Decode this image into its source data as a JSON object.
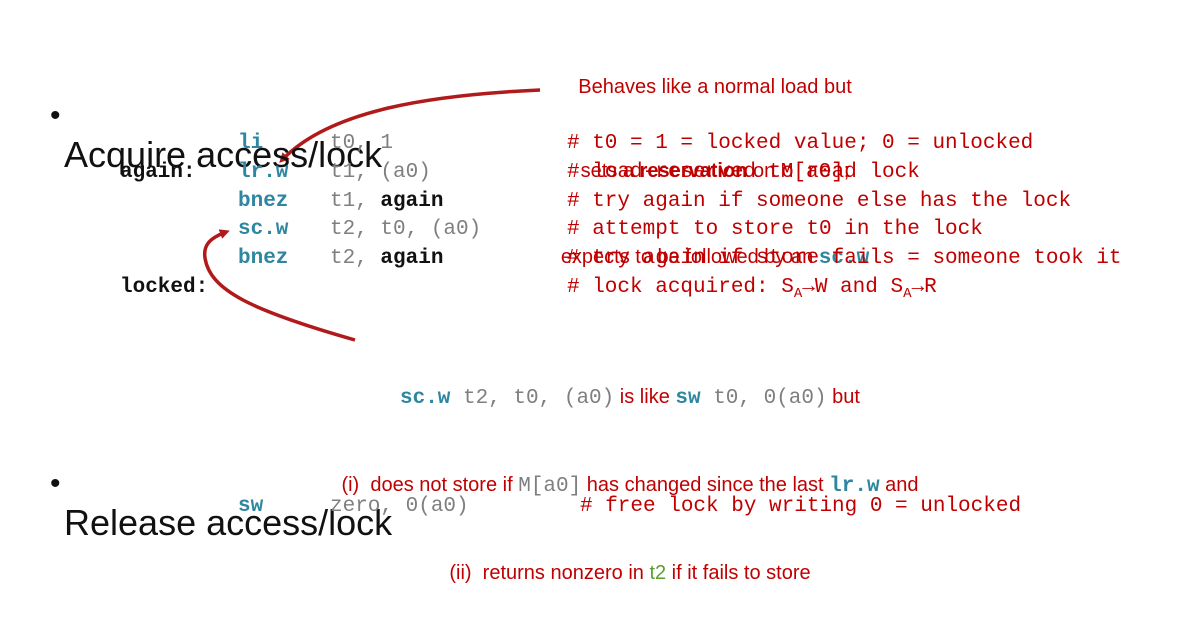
{
  "bullets": {
    "acquire": "Acquire access/lock",
    "release": "Release access/lock",
    "marker": "•"
  },
  "top_note": {
    "line1": "Behaves like a normal load but",
    "line2_pre": "sets a ",
    "line2_bold": "reservation",
    "line2_mid": " on ",
    "line2_code": "M[a0]",
    "line2_post": ";",
    "line3_pre": "expects to be followed by an ",
    "line3_code": "sc.w"
  },
  "code": [
    {
      "label": "",
      "op": "li",
      "a1": "t0, 1",
      "a2": "",
      "comment": "# t0 = 1 = locked value; 0 = unlocked"
    },
    {
      "label": "again:",
      "op": "lr.w",
      "a1": "t1, (a0)",
      "a2": "",
      "comment": "# load-reserved to read lock"
    },
    {
      "label": "",
      "op": "bnez",
      "a1": "t1, ",
      "a2": "again",
      "comment": "# try again if someone else has the lock"
    },
    {
      "label": "",
      "op": "sc.w",
      "a1": "t2, t0, (a0)",
      "a2": "",
      "comment": "# attempt to store t0 in the lock"
    },
    {
      "label": "",
      "op": "bnez",
      "a1": "t2, ",
      "a2": "again",
      "comment": "# try again if store fails = someone took it"
    },
    {
      "label": "locked:",
      "op": "",
      "a1": "",
      "a2": "",
      "comment": "# lock acquired: S"
    }
  ],
  "locked_comment": {
    "sub": "A",
    "arrow1": "→W and S",
    "arrow2": "→R"
  },
  "bottom_note": {
    "l1_code1": "sc.w",
    "l1_code1b": " t2, t0, (a0)",
    "l1_text1": " is like ",
    "l1_code2": "sw",
    "l1_code2b": " t0, 0(a0)",
    "l1_text2": " but",
    "l2_text1": "(i)  does not store if ",
    "l2_code1": "M[a0]",
    "l2_text2": " has changed since the last ",
    "l2_code2": "lr.w",
    "l2_text3": " and",
    "l3_text1": "(ii)  returns nonzero in ",
    "l3_reg": "t2",
    "l3_text2": " if it fails to store"
  },
  "release_code": {
    "op": "sw",
    "args": "zero, 0(a0)",
    "comment": "# free lock by writing 0 = unlocked"
  },
  "colors": {
    "instruction": "#2E86A0",
    "comment": "#C00000",
    "register_note": "#5A9E2F",
    "args": "#7F7F7F"
  }
}
